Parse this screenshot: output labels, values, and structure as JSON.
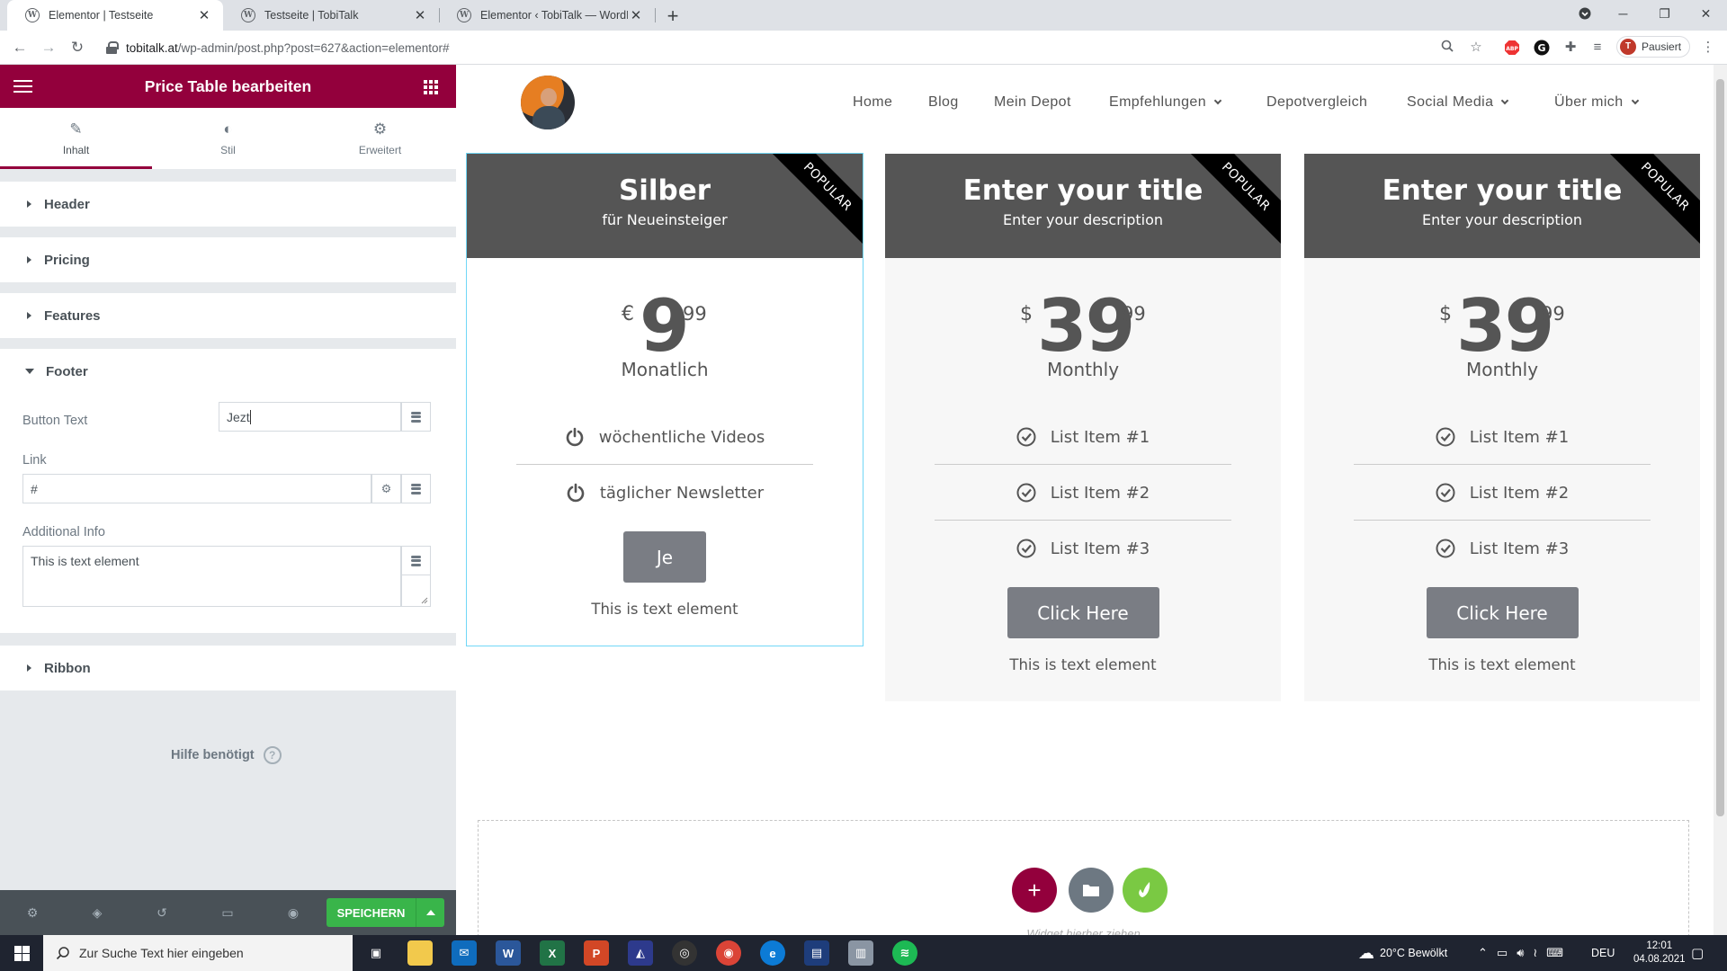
{
  "browser": {
    "tabs": [
      {
        "title": "Elementor | Testseite",
        "active": true
      },
      {
        "title": "Testseite | TobiTalk",
        "active": false
      },
      {
        "title": "Elementor ‹ TobiTalk — WordPre",
        "active": false
      }
    ],
    "url_host": "tobitalk.at",
    "url_path": "/wp-admin/post.php?post=627&action=elementor#",
    "profile_initial": "T",
    "profile_label": "Pausiert"
  },
  "panel": {
    "title": "Price Table bearbeiten",
    "tabs": [
      "Inhalt",
      "Stil",
      "Erweitert"
    ],
    "sections": {
      "header": "Header",
      "pricing": "Pricing",
      "features": "Features",
      "footer": "Footer",
      "ribbon": "Ribbon"
    },
    "footer_fields": {
      "button_text_label": "Button Text",
      "button_text_value": "Jezt",
      "link_label": "Link",
      "link_value": "#",
      "additional_info_label": "Additional Info",
      "additional_info_value": "This is text element"
    },
    "help": "Hilfe benötigt",
    "save": "SPEICHERN",
    "accent": "#93003c"
  },
  "site": {
    "nav": [
      "Home",
      "Blog",
      "Mein Depot",
      "Empfehlungen",
      "Depotvergleich",
      "Social Media",
      "Über mich"
    ],
    "cards": [
      {
        "title": "Silber",
        "desc": "für Neueinsteiger",
        "ribbon": "POPULAR",
        "currency": "€",
        "integer": "9",
        "fraction": "99",
        "period": "Monatlich",
        "features": [
          "wöchentliche Videos",
          "täglicher Newsletter"
        ],
        "button": "Je",
        "info": "This is text element"
      },
      {
        "title": "Enter your title",
        "desc": "Enter your description",
        "ribbon": "POPULAR",
        "currency": "$",
        "integer": "39",
        "fraction": "99",
        "period": "Monthly",
        "features": [
          "List Item #1",
          "List Item #2",
          "List Item #3"
        ],
        "button": "Click Here",
        "info": "This is text element"
      },
      {
        "title": "Enter your title",
        "desc": "Enter your description",
        "ribbon": "POPULAR",
        "currency": "$",
        "integer": "39",
        "fraction": "99",
        "period": "Monthly",
        "features": [
          "List Item #1",
          "List Item #2",
          "List Item #3"
        ],
        "button": "Click Here",
        "info": "This is text element"
      }
    ],
    "dropzone_hint": "Widget hierher ziehen"
  },
  "taskbar": {
    "search_placeholder": "Zur Suche Text hier eingeben",
    "weather": "20°C  Bewölkt",
    "lang": "DEU",
    "time": "12:01",
    "date": "04.08.2021"
  }
}
